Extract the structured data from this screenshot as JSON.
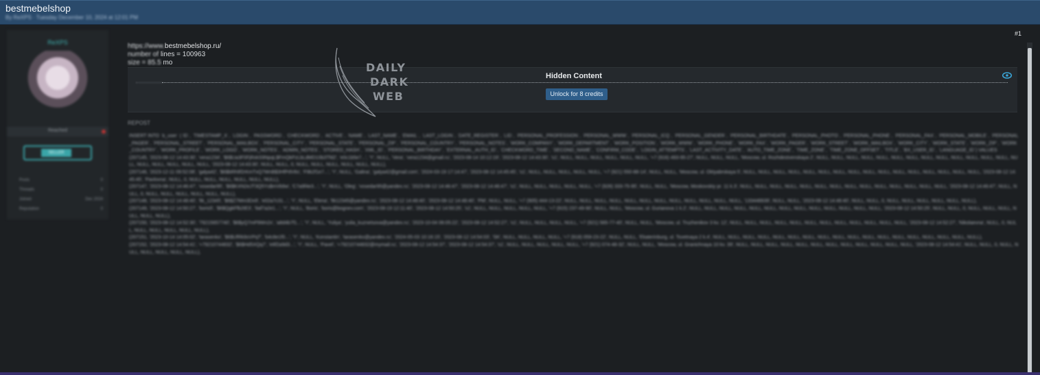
{
  "header": {
    "title": "bestmebelshop",
    "subtitle": "By ReXPS · Tuesday December 10, 2024 at 12:01 PM"
  },
  "user": {
    "name": "ReXPS",
    "status": "Reached",
    "badge": "SELLER",
    "stats": [
      {
        "label": "Posts",
        "value": "0"
      },
      {
        "label": "Threads",
        "value": "0"
      },
      {
        "label": "Joined",
        "value": "Dec 2024"
      },
      {
        "label": "Reputation",
        "value": "0"
      }
    ]
  },
  "post": {
    "number": "#1",
    "line1_blur": "https://www.",
    "line1_site": "bestmebelshop.ru/",
    "line2_blur": "number of",
    "line2_rest": "lines =  100963",
    "line3_blur": "size = 85.5",
    "line3_rest": "mo",
    "hidden": {
      "title": "Hidden Content",
      "button": "Unlock for 8 credits"
    },
    "watermark": [
      "DAILY",
      "DARK",
      "WEB"
    ],
    "section_label": "REPOST",
    "dump_text": "INSERT INTO `b_user` (`ID`, `TIMESTAMP_X`, `LOGIN`, `PASSWORD`, `CHECKWORD`, `ACTIVE`, `NAME`, `LAST_NAME`, `EMAIL`, `LAST_LOGIN`, `DATE_REGISTER`, `LID`, `PERSONAL_PROFESSION`, `PERSONAL_WWW`, `PERSONAL_ICQ`, `PERSONAL_GENDER`, `PERSONAL_BIRTHDATE`, `PERSONAL_PHOTO`, `PERSONAL_PHONE`, `PERSONAL_FAX`, `PERSONAL_MOBILE`, `PERSONAL_PAGER`, `PERSONAL_STREET`, `PERSONAL_MAILBOX`, `PERSONAL_CITY`, `PERSONAL_STATE`, `PERSONAL_ZIP`, `PERSONAL_COUNTRY`, `PERSONAL_NOTES`, `WORK_COMPANY`, `WORK_DEPARTMENT`, `WORK_POSITION`, `WORK_WWW`, `WORK_PHONE`, `WORK_FAX`, `WORK_PAGER`, `WORK_STREET`, `WORK_MAILBOX`, `WORK_CITY`, `WORK_STATE`, `WORK_ZIP`, `WORK_COUNTRY`, `WORK_PROFILE`, `WORK_LOGO`, `WORK_NOTES`, `ADMIN_NOTES`, `STORED_HASH`, `XML_ID`, `PERSONAL_BIRTHDAY`, `EXTERNAL_AUTH_ID`, `CHECKWORD_TIME`, `SECOND_NAME`, `CONFIRM_CODE`, `LOGIN_ATTEMPTS`, `LAST_ACTIVITY_DATE`, `AUTO_TIME_ZONE`, `TIME_ZONE`, `TIME_ZONE_OFFSET`, `TITLE`, `BX_USER_ID`, `LANGUAGE_ID`) VALUES\n(207145, '2023-08-12 14:43:30', 'vera1234', '$6$Ua3F0FjRxkS9NpqL$FmQkPzLbLdMD10b3Tfd2', 'e0c1b5e7...', 'Y', NULL, 'Vera', 'vera1234@gmail.ru', '2023-08-14 10:12:19', '2023-08-12 14:43:30', 's1', NULL, NULL, NULL, NULL, NULL, NULL, '+7 (916) 493-95-27', NULL, NULL, NULL, 'Moscow, ul. Rozhdestvenskaya 2', NULL, NULL, NULL, NULL, NULL, NULL, NULL, NULL, NULL, NULL, NULL, NULL, NULL, NULL, NULL, NULL, NULL, NULL, NULL, '2023-08-12 14:43:30', NULL, NULL, 0, NULL, NULL, NULL, NULL, NULL, NULL),\n(207146, '2023-12-11 09:52:08', 'galya42', '$6$bRh9f2rKmTxQ7WnB$3HfPdV8s', 'F9b2f1e7...', 'Y', NULL, 'Galina', 'galya42@gmail.com', '2024-03-19 17:14:47', '2023-08-12 14:45:45', 's1', NULL, NULL, NULL, NULL, NULL, '+7 (921) 550-88-14', NULL, NULL, 'Moscow, ul. Oktyabrskaya 5', NULL, NULL, NULL, NULL, NULL, NULL, NULL, NULL, NULL, NULL, NULL, NULL, NULL, NULL, NULL, NULL, '2023-08-12 14:45:45', 'Pavlovna', NULL, 0, NULL, NULL, NULL, NULL, NULL, NULL),\n(207147, '2023-08-12 14:46:47', 'vosedar95', '$6$KXN2eJT3Q5Ys$mVb9w', 'C7a9f4e3...', 'Y', NULL, 'Oleg', 'vosedar95@yandex.ru', '2023-08-12 14:46:47', '2023-08-12 14:46:47', 's1', NULL, NULL, NULL, NULL, NULL, '+7 (926) 333-75-95', NULL, NULL, 'Moscow, Moskovskiy pr. 11 k.3', NULL, NULL, NULL, NULL, NULL, NULL, NULL, NULL, NULL, NULL, NULL, NULL, NULL, NULL, '2023-08-12 14:46:47', NULL, NULL, 0, NULL, NULL, NULL, NULL, NULL, NULL),\n(207148, '2023-08-12 14:48:40', 'ltk_12345', '$6$Z7Mm3Dx9', 'e02a7c31...', 'Y', NULL, 'Elena', 'ltk12345@yandex.ru', '2023-08-12 14:48:40', '2023-08-12 14:48:40', 'PM', NULL, NULL, '+7 (905) 444-13-22', NULL, NULL, NULL, NULL, NULL, NULL, NULL, NULL, NULL, NULL, NULL, NULL, '133448939', NULL, NULL, '2023-08-12 14:48:40', NULL, NULL, 0, NULL, NULL, NULL, NULL, NULL, NULL),\n(207149, '2023-08-12 14:50:27', 'boris5', '$6$QgkFfb2tE3', '9af7a2e1...', 'Y', NULL, 'Boris', 'boris@bognev.com', '2023-08-19 12:11:40', '2023-08-12 14:50:25', 's1', NULL, NULL, NULL, NULL, NULL, '+7 (915) 237-49-90', NULL, NULL, 'Moscow, ul. Gurianova 1 k.2', NULL, NULL, NULL, NULL, NULL, NULL, NULL, NULL, NULL, NULL, NULL, NULL, NULL, '2023-08-12 14:50:25', NULL, NULL, 0, NULL, NULL, NULL, NULL, NULL, NULL),\n(207150, '2023-08-12 14:52:30', '79215657740', '$6$yQ7mP9Wn2x', 'a8d4b7f1...', 'Y', NULL, 'Yuliya', 'yulia_kuznetsova@yandex.ru', '2023-10-04 06:05:22', '2023-08-12 14:52:27', 's1', NULL, NULL, NULL, NULL, '+7 (921) 565-77-40', NULL, NULL, 'Moscow, ul. Truzhenikov 3 kv. 12', NULL, NULL, NULL, NULL, NULL, NULL, NULL, NULL, NULL, NULL, NULL, NULL, '2023-08-12 14:52:27', 'Nikolaevna', NULL, 0, NULL, NULL, NULL, NULL, NULL, NULL),\n(207151, '2023-10-14 14:05:02', 'tarasenko', '$6$UfRk9sVPqT', 'b4c8e1f0...', 'Y', NULL, 'Konstantin', 'tarasenko@yandex.ru', '2024-05-03 10:16:15', '2023-08-12 14:54:03', 'SK', NULL, NULL, NULL, NULL, '+7 (918) 059-23-22', NULL, NULL, 'Ekaterinburg, ul. Tsvetnaya 2 k.4', NULL, NULL, NULL, NULL, NULL, NULL, NULL, NULL, NULL, NULL, NULL, NULL, NULL, NULL, NULL, NULL, NULL, NULL),\n(207152, '2023-08-12 14:54:41', '+79210744832', '$6$Hd5XQq7', 'e6f2a9d3...', 'Y', NULL, 'Pavel', '+79210744832@mymail.ru', '2023-08-12 14:54:37', '2023-08-12 14:54:37', 's1', NULL, NULL, NULL, NULL, NULL, '+7 (921) 074-48-32', NULL, NULL, 'Moscow, ul. Granichnaya 10 kv. 39', NULL, NULL, NULL, NULL, NULL, NULL, NULL, NULL, NULL, NULL, NULL, NULL, '2023-08-12 14:54:41', NULL, NULL, 0, NULL, NULL, NULL, NULL, NULL, NULL),"
  }
}
